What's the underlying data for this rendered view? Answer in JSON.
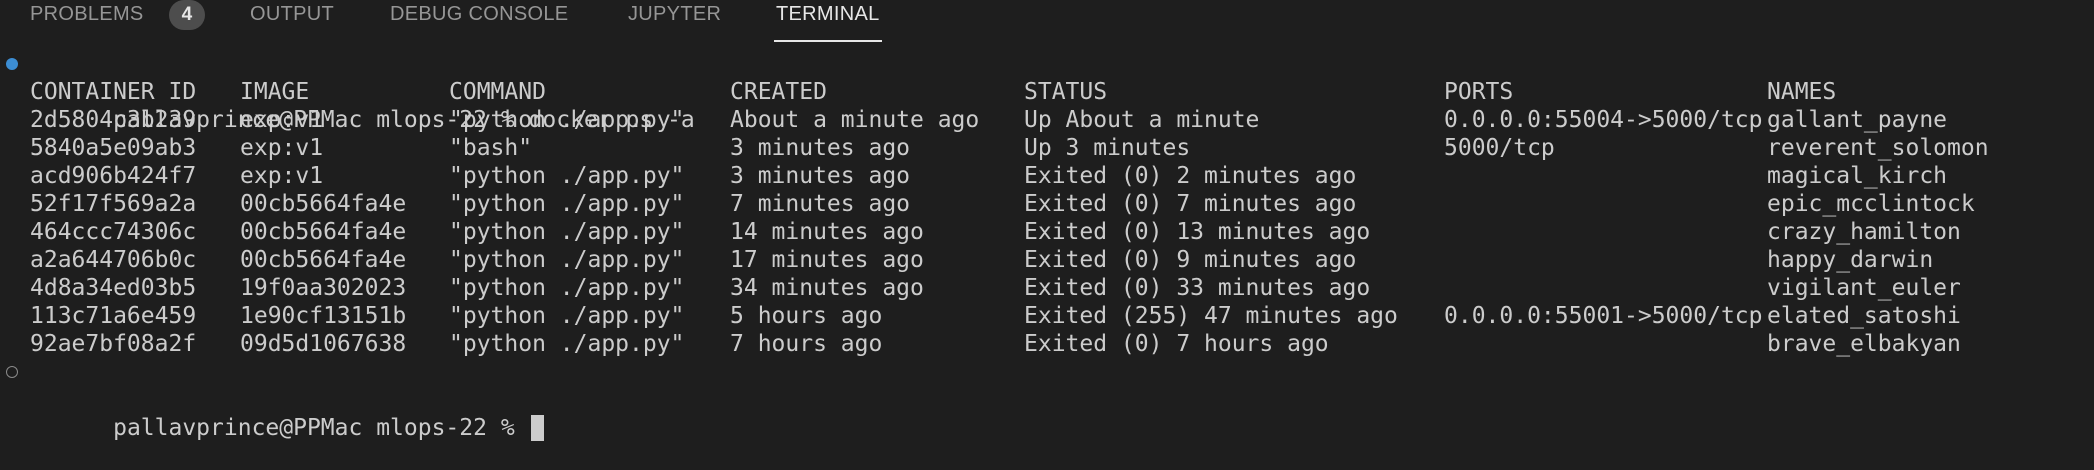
{
  "tabs": {
    "problems": "PROBLEMS",
    "problems_count": "4",
    "output": "OUTPUT",
    "debug_console": "DEBUG CONSOLE",
    "jupyter": "JUPYTER",
    "terminal": "TERMINAL",
    "active": "TERMINAL"
  },
  "terminal": {
    "prompt": "pallavprince@PPMac mlops-22 %",
    "command": "docker ps -a",
    "headers": {
      "container_id": "CONTAINER ID",
      "image": "IMAGE",
      "command": "COMMAND",
      "created": "CREATED",
      "status": "STATUS",
      "ports": "PORTS",
      "names": "NAMES"
    },
    "rows": [
      {
        "container_id": "2d5804c3b239",
        "image": "exp:v1",
        "command": "\"python ./app.py\"",
        "created": "About a minute ago",
        "status": "Up About a minute",
        "ports": "0.0.0.0:55004->5000/tcp",
        "names": "gallant_payne"
      },
      {
        "container_id": "5840a5e09ab3",
        "image": "exp:v1",
        "command": "\"bash\"",
        "created": "3 minutes ago",
        "status": "Up 3 minutes",
        "ports": "5000/tcp",
        "names": "reverent_solomon"
      },
      {
        "container_id": "acd906b424f7",
        "image": "exp:v1",
        "command": "\"python ./app.py\"",
        "created": "3 minutes ago",
        "status": "Exited (0) 2 minutes ago",
        "ports": "",
        "names": "magical_kirch"
      },
      {
        "container_id": "52f17f569a2a",
        "image": "00cb5664fa4e",
        "command": "\"python ./app.py\"",
        "created": "7 minutes ago",
        "status": "Exited (0) 7 minutes ago",
        "ports": "",
        "names": "epic_mcclintock"
      },
      {
        "container_id": "464ccc74306c",
        "image": "00cb5664fa4e",
        "command": "\"python ./app.py\"",
        "created": "14 minutes ago",
        "status": "Exited (0) 13 minutes ago",
        "ports": "",
        "names": "crazy_hamilton"
      },
      {
        "container_id": "a2a644706b0c",
        "image": "00cb5664fa4e",
        "command": "\"python ./app.py\"",
        "created": "17 minutes ago",
        "status": "Exited (0) 9 minutes ago",
        "ports": "",
        "names": "happy_darwin"
      },
      {
        "container_id": "4d8a34ed03b5",
        "image": "19f0aa302023",
        "command": "\"python ./app.py\"",
        "created": "34 minutes ago",
        "status": "Exited (0) 33 minutes ago",
        "ports": "",
        "names": "vigilant_euler"
      },
      {
        "container_id": "113c71a6e459",
        "image": "1e90cf13151b",
        "command": "\"python ./app.py\"",
        "created": "5 hours ago",
        "status": "Exited (255) 47 minutes ago",
        "ports": "0.0.0.0:55001->5000/tcp",
        "names": "elated_satoshi"
      },
      {
        "container_id": "92ae7bf08a2f",
        "image": "09d5d1067638",
        "command": "\"python ./app.py\"",
        "created": "7 hours ago",
        "status": "Exited (0) 7 hours ago",
        "ports": "",
        "names": "brave_elbakyan"
      }
    ],
    "colors": {
      "background": "#1e1e1e",
      "text": "#cccccc",
      "success_dot": "#3c8dd3",
      "tab_inactive": "#969696",
      "tab_active": "#e7e7e7"
    }
  }
}
